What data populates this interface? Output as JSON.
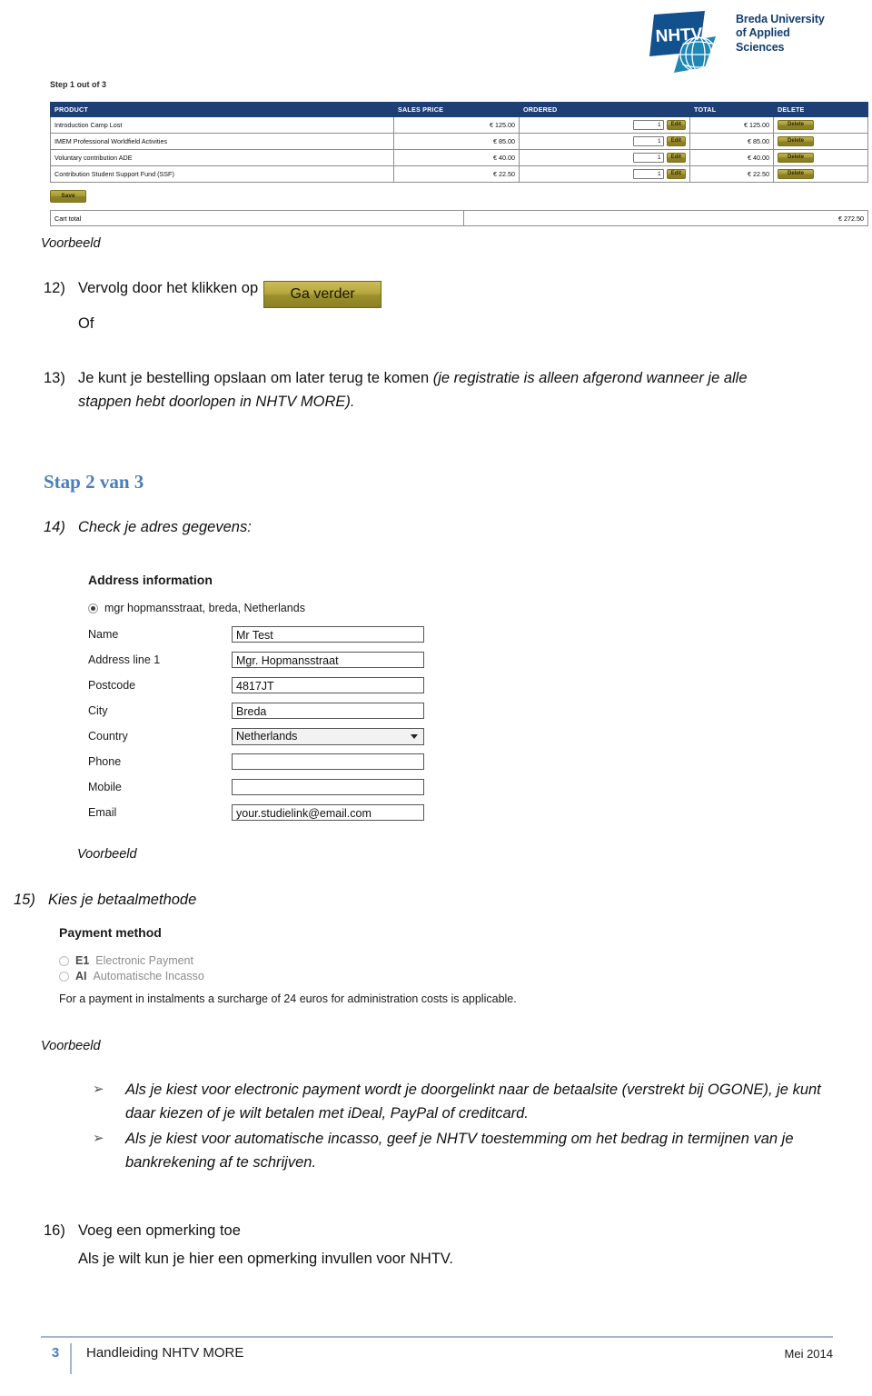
{
  "header": {
    "logo_mark_text": "NHTV",
    "logo_name_line1": "Breda University",
    "logo_name_line2": "of Applied",
    "logo_name_line3": "Sciences",
    "brand_color": "#123E72",
    "globe_color": "#1E87B5"
  },
  "cart_screenshot": {
    "step_label": "Step 1 out of 3",
    "columns": [
      "PRODUCT",
      "SALES PRICE",
      "ORDERED",
      "TOTAL",
      "DELETE"
    ],
    "header_color": "#1D3F76",
    "rows": [
      {
        "product": "Introduction Camp Lost",
        "sales_price": "€ 125.00",
        "qty": "1",
        "edit_label": "Edit",
        "total": "€ 125.00",
        "delete_label": "Delete"
      },
      {
        "product": "IMEM Professional Worldfield Activities",
        "sales_price": "€ 85.00",
        "qty": "1",
        "edit_label": "Edit",
        "total": "€ 85.00",
        "delete_label": "Delete"
      },
      {
        "product": "Voluntary contribution ADE",
        "sales_price": "€ 40.00",
        "qty": "1",
        "edit_label": "Edit",
        "total": "€ 40.00",
        "delete_label": "Delete"
      },
      {
        "product": "Contribution Student Support Fund (SSF)",
        "sales_price": "€ 22.50",
        "qty": "1",
        "edit_label": "Edit",
        "total": "€ 22.50",
        "delete_label": "Delete"
      }
    ],
    "save_label": "Save",
    "cart_total_label": "Cart total",
    "cart_total_amount": "€ 272.50",
    "button_color": "#A79A33"
  },
  "captions": {
    "voorbeeld_1": "Voorbeeld",
    "voorbeeld_2": "Voorbeeld",
    "voorbeeld_3": "Voorbeeld"
  },
  "steps": {
    "item12_number": "12)",
    "item12_text": "Vervolg door het klikken op",
    "item12_button": "Ga verder",
    "item12_or": "Of",
    "item13_number": "13)",
    "item13_text_plain": "Je kunt je bestelling opslaan om later terug te komen ",
    "item13_text_italic": "(je registratie is alleen afgerond wanneer je alle stappen hebt doorlopen in NHTV MORE).",
    "stap_heading": "Stap 2 van 3",
    "stap_heading_color": "#4A7EBB",
    "item14_number": "14)",
    "item14_text": "Check je adres gegevens:",
    "item15_number": "15)",
    "item15_text": "Kies je betaalmethode",
    "item16_number": "16)",
    "item16_text": "Voeg een opmerking toe",
    "item16_subtext": "Als je wilt kun je hier een opmerking invullen voor NHTV."
  },
  "address_screenshot": {
    "title": "Address information",
    "selected_address": "mgr hopmansstraat, breda, Netherlands",
    "fields": [
      {
        "label": "Name",
        "value": "Mr Test",
        "type": "text"
      },
      {
        "label": "Address line 1",
        "value": "Mgr. Hopmansstraat",
        "type": "text-caret"
      },
      {
        "label": "Postcode",
        "value": "4817JT",
        "type": "text"
      },
      {
        "label": "City",
        "value": "Breda",
        "type": "text"
      },
      {
        "label": "Country",
        "value": "Netherlands",
        "type": "select"
      },
      {
        "label": "Phone",
        "value": "",
        "type": "text"
      },
      {
        "label": "Mobile",
        "value": "",
        "type": "text"
      },
      {
        "label": "Email",
        "value": "your.studielink@email.com",
        "type": "text"
      }
    ]
  },
  "payment_screenshot": {
    "title": "Payment method",
    "options": [
      {
        "code": "E1",
        "label": "Electronic Payment"
      },
      {
        "code": "AI",
        "label": "Automatische Incasso"
      }
    ],
    "note": "For a payment in instalments a surcharge of 24 euros for administration costs is applicable."
  },
  "bullets": {
    "marker": "➢",
    "items": [
      "Als je kiest voor electronic payment wordt je doorgelinkt naar de betaalsite (verstrekt bij OGONE), je kunt daar kiezen of je wilt betalen met iDeal, PayPal of creditcard.",
      "Als je kiest voor automatische incasso, geef je NHTV toestemming om het bedrag in termijnen van je bankrekening af te schrijven."
    ]
  },
  "footer": {
    "page_number": "3",
    "title": "Handleiding NHTV MORE",
    "date": "Mei 2014",
    "accent_color": "#4A7EBB"
  }
}
